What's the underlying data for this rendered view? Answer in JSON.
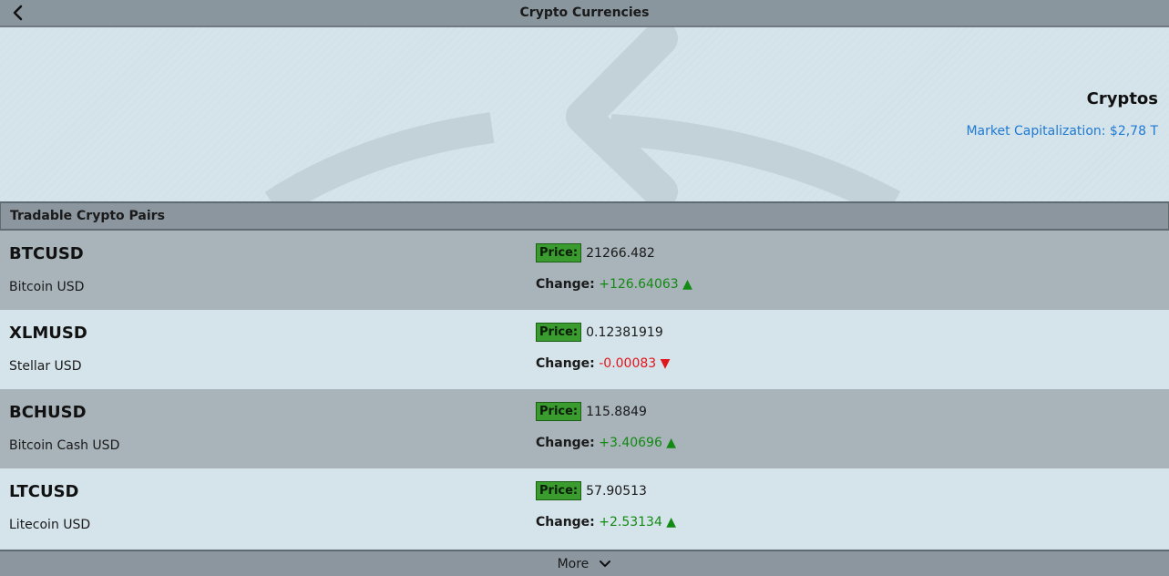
{
  "header": {
    "title": "Crypto Currencies"
  },
  "hero": {
    "heading": "Cryptos",
    "market_cap": "Market Capitalization: $2,78 T"
  },
  "section": {
    "title": "Tradable Crypto Pairs"
  },
  "pairs": [
    {
      "symbol": "BTCUSD",
      "name": "Bitcoin USD",
      "price_label": "Price:",
      "price": "21266.482",
      "change_label": "Change:",
      "change": "+126.64063 ▲",
      "direction": "up"
    },
    {
      "symbol": "XLMUSD",
      "name": "Stellar USD",
      "price_label": "Price:",
      "price": "0.12381919",
      "change_label": "Change:",
      "change": "-0.00083 ▼",
      "direction": "down"
    },
    {
      "symbol": "BCHUSD",
      "name": "Bitcoin Cash USD",
      "price_label": "Price:",
      "price": "115.8849",
      "change_label": "Change:",
      "change": "+3.40696 ▲",
      "direction": "up"
    },
    {
      "symbol": "LTCUSD",
      "name": "Litecoin USD",
      "price_label": "Price:",
      "price": "57.90513",
      "change_label": "Change:",
      "change": "+2.53134 ▲",
      "direction": "up"
    }
  ],
  "footer": {
    "more_label": "More"
  },
  "colors": {
    "up": "#138a13",
    "down": "#e0161b",
    "accent": "#1f7ad3",
    "price_badge": "#3a9c2e"
  },
  "icons": {
    "back": "chevron-left-icon",
    "more": "chevron-down-icon",
    "hero": "refresh-arrow-icon"
  }
}
